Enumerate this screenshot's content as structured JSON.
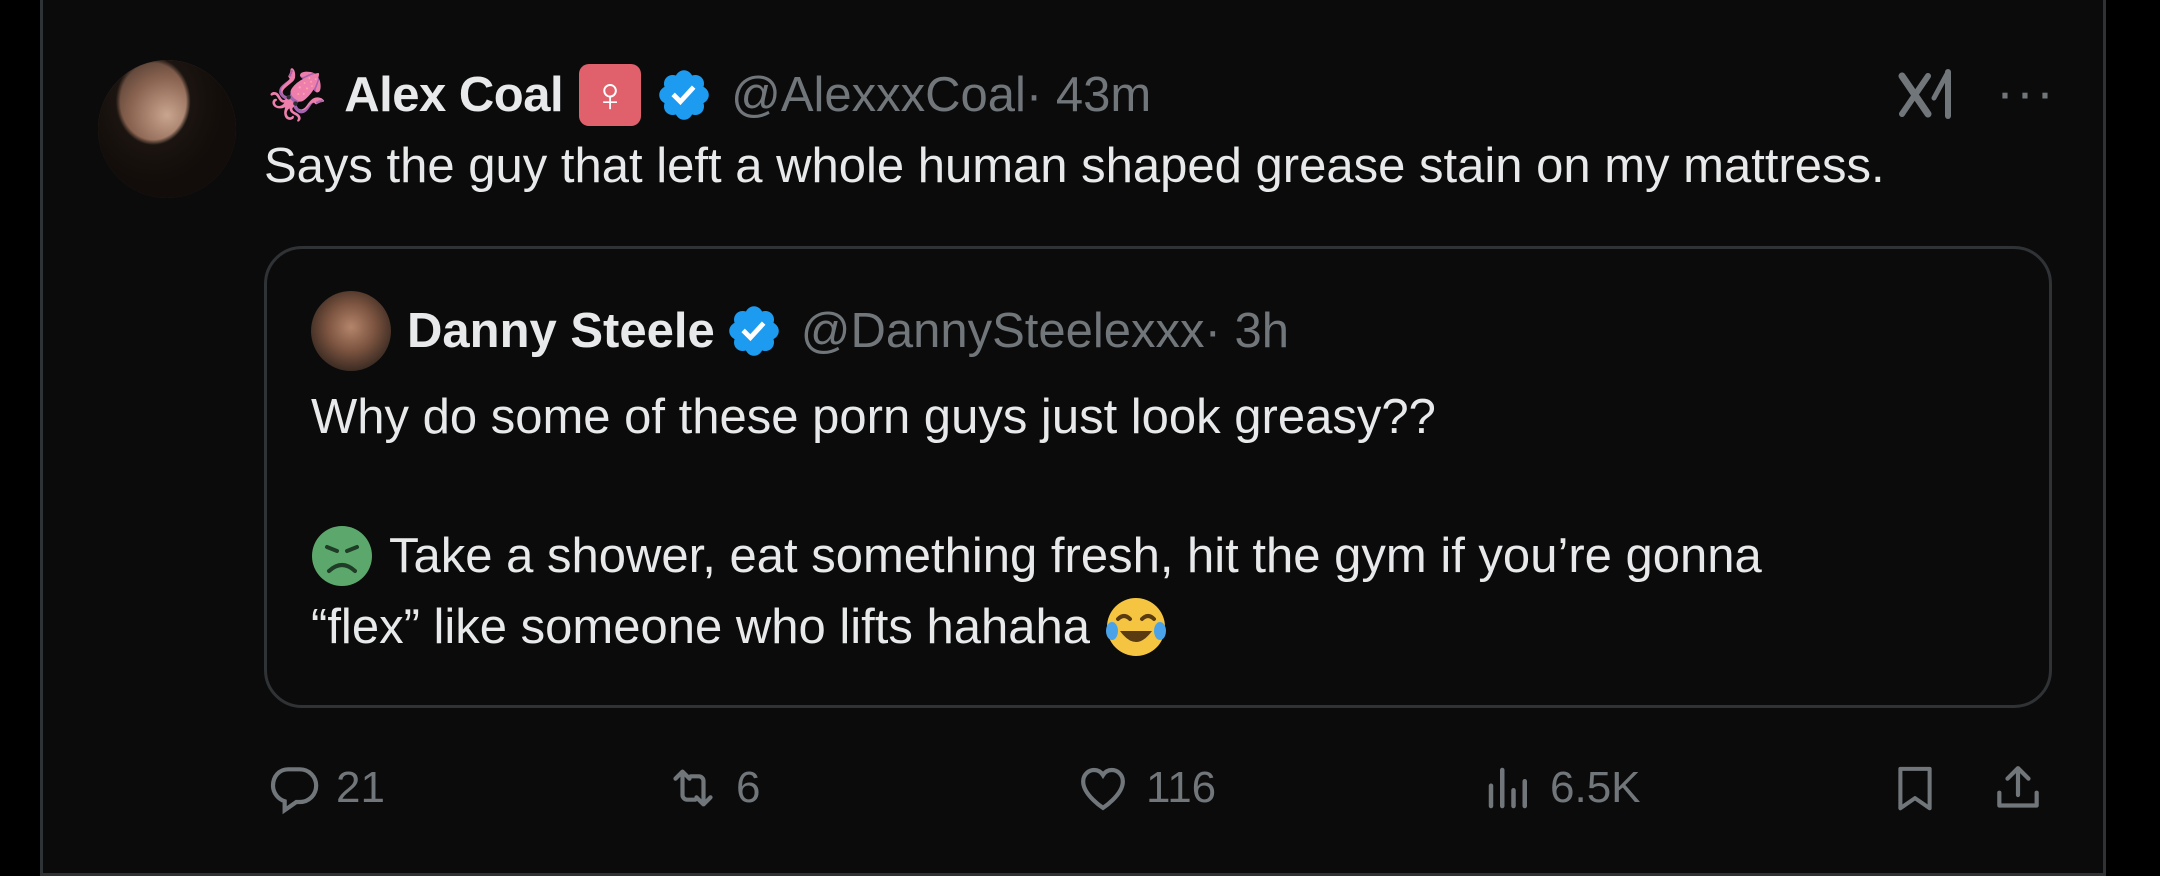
{
  "tweet": {
    "author_name": "Alex Coal",
    "author_handle": "@AlexxxCoal",
    "time": " · 43m",
    "squid_emoji": "🦑",
    "female_symbol": "♀",
    "text": "Says the guy that left a whole human shaped grease stain on my mattress.",
    "more_label": "···"
  },
  "quote": {
    "author_name": "Danny Steele",
    "author_handle": "@DannySteelexxx",
    "time": " · 3h",
    "line1": "Why do some of these porn guys just look greasy??",
    "line2": "Take a shower, eat something fresh, hit the gym if you’re gonna",
    "line3": "“flex” like someone who lifts hahaha"
  },
  "actions": {
    "replies": "21",
    "reposts": "6",
    "likes": "116",
    "views": "6.5K"
  },
  "colors": {
    "background": "#000000",
    "card": "#0b0b0b",
    "border": "#2f3336",
    "text": "#e7e9ea",
    "muted": "#71767b",
    "verified_blue": "#1d9bf0",
    "female_badge": "#e0616c"
  },
  "icons": [
    "squid-icon",
    "female-sign-icon",
    "verified-icon",
    "grok-icon",
    "more-icon",
    "reply-icon",
    "repost-icon",
    "like-icon",
    "views-icon",
    "bookmark-icon",
    "share-icon",
    "nauseated-face-icon",
    "tears-of-joy-icon"
  ]
}
